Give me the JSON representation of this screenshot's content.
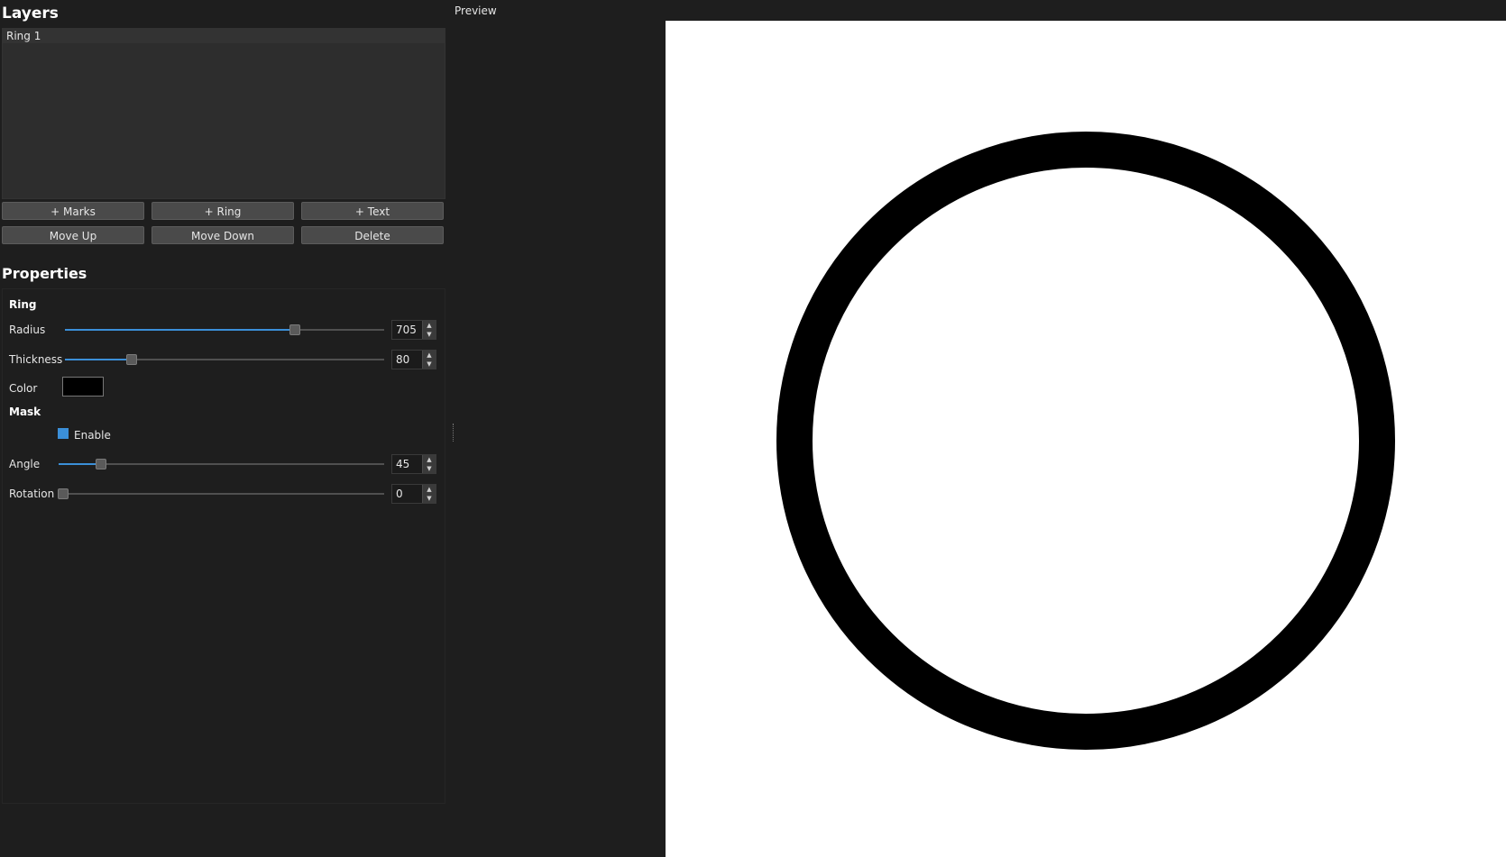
{
  "layers": {
    "title": "Layers",
    "items": [
      {
        "label": "Ring 1"
      }
    ]
  },
  "buttons": {
    "add_marks": "+ Marks",
    "add_ring": "+ Ring",
    "add_text": "+ Text",
    "move_up": "Move Up",
    "move_down": "Move Down",
    "delete": "Delete"
  },
  "properties": {
    "title": "Properties",
    "ring_section": "Ring",
    "radius": {
      "label": "Radius",
      "value": "705",
      "level": 0.72
    },
    "thickness": {
      "label": "Thickness",
      "value": "80",
      "level": 0.21
    },
    "color": {
      "label": "Color",
      "value": "#000000"
    },
    "mask_section": "Mask",
    "enable": {
      "label": "Enable",
      "checked": true
    },
    "angle": {
      "label": "Angle",
      "value": "45",
      "level": 0.13
    },
    "rotation": {
      "label": "Rotation",
      "value": "0",
      "level": 0
    }
  },
  "preview": {
    "label": "Preview",
    "ring_color": "#000000",
    "background": "#ffffff"
  },
  "colors": {
    "accent": "#3b8fd8"
  }
}
